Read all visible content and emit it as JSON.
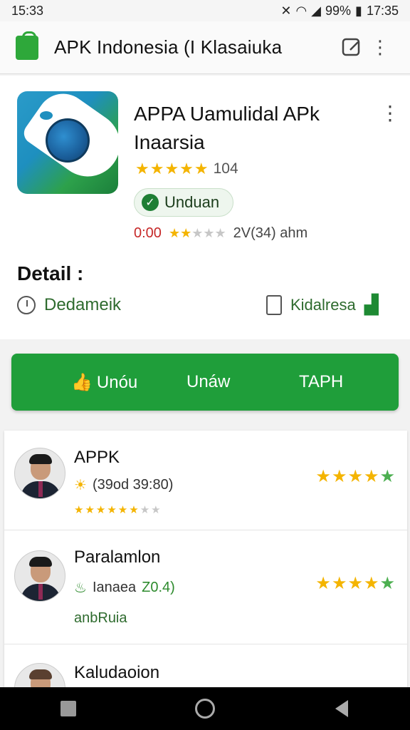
{
  "status_bar": {
    "time_left": "15:33",
    "battery": "99%",
    "time_right": "17:35"
  },
  "app_bar": {
    "title": "APK Indonesia (I Klasaiuka"
  },
  "app": {
    "name": "APPA Uamulidal APk Inaarsia",
    "rating_stars": "★★★★★",
    "rating_count": "104",
    "rating": 4.5,
    "install_label": "Unduan",
    "meta_red": "0:00",
    "meta_stars": 2,
    "meta_size": "2V(34) ahm"
  },
  "detail": {
    "title": "Detail :",
    "left_label": "Dedameik",
    "right_label": "Kidalresa"
  },
  "actions": {
    "btn1": "Unóu",
    "btn2": "Unáw",
    "btn3": "TAPH"
  },
  "reviews": [
    {
      "name": "APPK",
      "meta": "(39od 39:80)",
      "stars_big": 4.5,
      "small_stars": 6,
      "small_stars_total": 8
    },
    {
      "name": "Paralamlon",
      "meta": "Ianaea",
      "meta_value": "Z0.4)",
      "tag": "anbRuia",
      "stars_big": 4.5
    },
    {
      "name": "Kaludaoion"
    }
  ],
  "colors": {
    "accent_green": "#1f9e3a",
    "star": "#f4b400",
    "red": "#c62828"
  },
  "icons": [
    "bag-icon",
    "search-icon",
    "more-icon",
    "check-icon",
    "clock-icon",
    "shopping-bag-icon",
    "chart-icon",
    "thumbs-up-icon",
    "sun-icon",
    "leaf-icon",
    "home-icon",
    "back-icon",
    "recents-icon"
  ]
}
